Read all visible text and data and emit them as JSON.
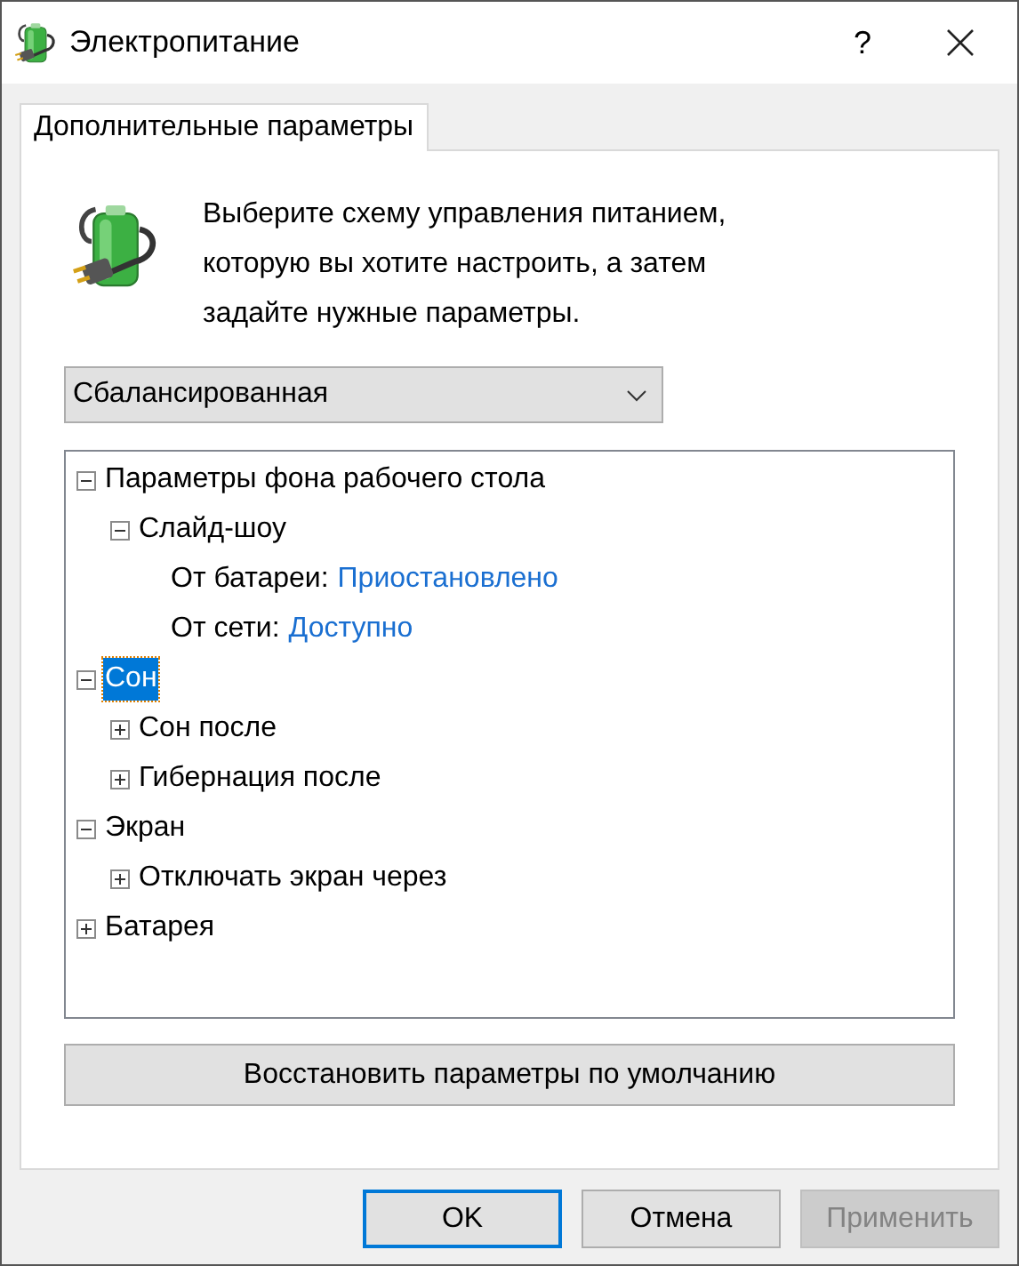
{
  "window": {
    "title": "Электропитание",
    "help": "?"
  },
  "tabs": [
    {
      "label": "Дополнительные параметры",
      "selected": true
    }
  ],
  "intro": "Выберите схему управления питанием, которую вы хотите настроить, а затем задайте нужные параметры.",
  "plan_dropdown": {
    "value": "Сбалансированная"
  },
  "tree": [
    {
      "kind": "group",
      "label": "Параметры фона рабочего стола",
      "expanded": true,
      "selected": false,
      "children": [
        {
          "kind": "group",
          "label": "Слайд-шоу",
          "expanded": true,
          "selected": false,
          "children": [
            {
              "kind": "setting",
              "label": "От батареи:",
              "value": "Приостановлено"
            },
            {
              "kind": "setting",
              "label": "От сети:",
              "value": "Доступно"
            }
          ]
        }
      ]
    },
    {
      "kind": "group",
      "label": "Сон",
      "expanded": true,
      "selected": true,
      "children": [
        {
          "kind": "group",
          "label": "Сон после",
          "expanded": false,
          "selected": false
        },
        {
          "kind": "group",
          "label": "Гибернация после",
          "expanded": false,
          "selected": false
        }
      ]
    },
    {
      "kind": "group",
      "label": "Экран",
      "expanded": true,
      "selected": false,
      "children": [
        {
          "kind": "group",
          "label": "Отключать экран через",
          "expanded": false,
          "selected": false
        }
      ]
    },
    {
      "kind": "group",
      "label": "Батарея",
      "expanded": false,
      "selected": false
    }
  ],
  "restore_button": "Восстановить параметры по умолчанию",
  "buttons": [
    {
      "label": "OK",
      "default": true,
      "disabled": false
    },
    {
      "label": "Отмена",
      "default": false,
      "disabled": false
    },
    {
      "label": "Применить",
      "default": false,
      "disabled": true
    }
  ]
}
